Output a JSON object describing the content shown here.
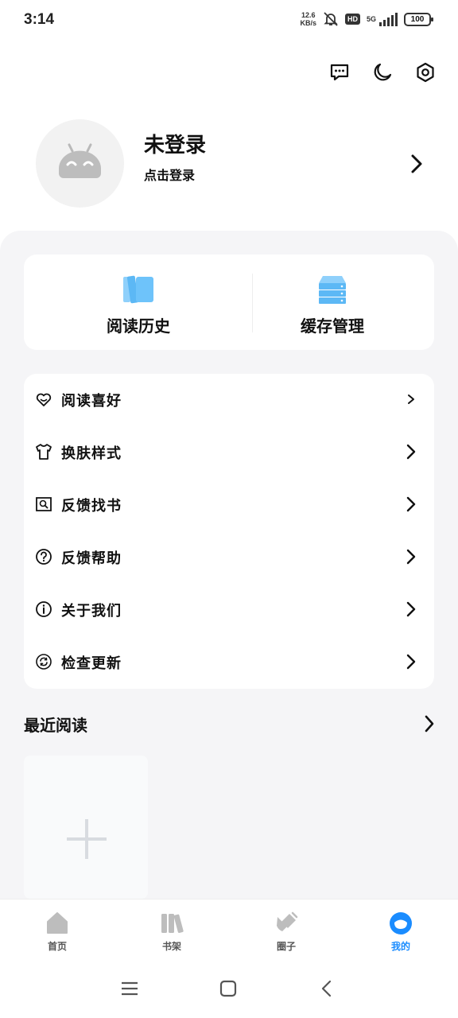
{
  "status_bar": {
    "time": "3:14",
    "net_speed_value": "12.6",
    "net_speed_unit": "KB/s",
    "hd_badge": "HD",
    "signal_label": "5G",
    "battery": "100"
  },
  "header_icons": [
    "message-icon",
    "moon-icon",
    "settings-icon"
  ],
  "profile": {
    "name": "未登录",
    "subtitle": "点击登录"
  },
  "quick_actions": [
    {
      "label": "阅读历史",
      "icon": "history-books-icon"
    },
    {
      "label": "缓存管理",
      "icon": "cache-server-icon"
    }
  ],
  "menu": [
    {
      "label": "阅读喜好",
      "icon": "heart-icon"
    },
    {
      "label": "换肤样式",
      "icon": "tshirt-icon"
    },
    {
      "label": "反馈找书",
      "icon": "search-book-icon"
    },
    {
      "label": "反馈帮助",
      "icon": "help-icon"
    },
    {
      "label": "关于我们",
      "icon": "info-icon"
    },
    {
      "label": "检查更新",
      "icon": "refresh-icon"
    }
  ],
  "recent": {
    "title": "最近阅读"
  },
  "bottom_nav": {
    "items": [
      {
        "label": "首页",
        "icon": "home-icon",
        "active": false
      },
      {
        "label": "书架",
        "icon": "bookshelf-icon",
        "active": false
      },
      {
        "label": "圈子",
        "icon": "circle-icon",
        "active": false
      },
      {
        "label": "我的",
        "icon": "profile-icon",
        "active": true
      }
    ]
  },
  "colors": {
    "accent": "#1a8cff",
    "icon_blue": "#5cb8f5",
    "background_grey": "#f5f5f7"
  }
}
